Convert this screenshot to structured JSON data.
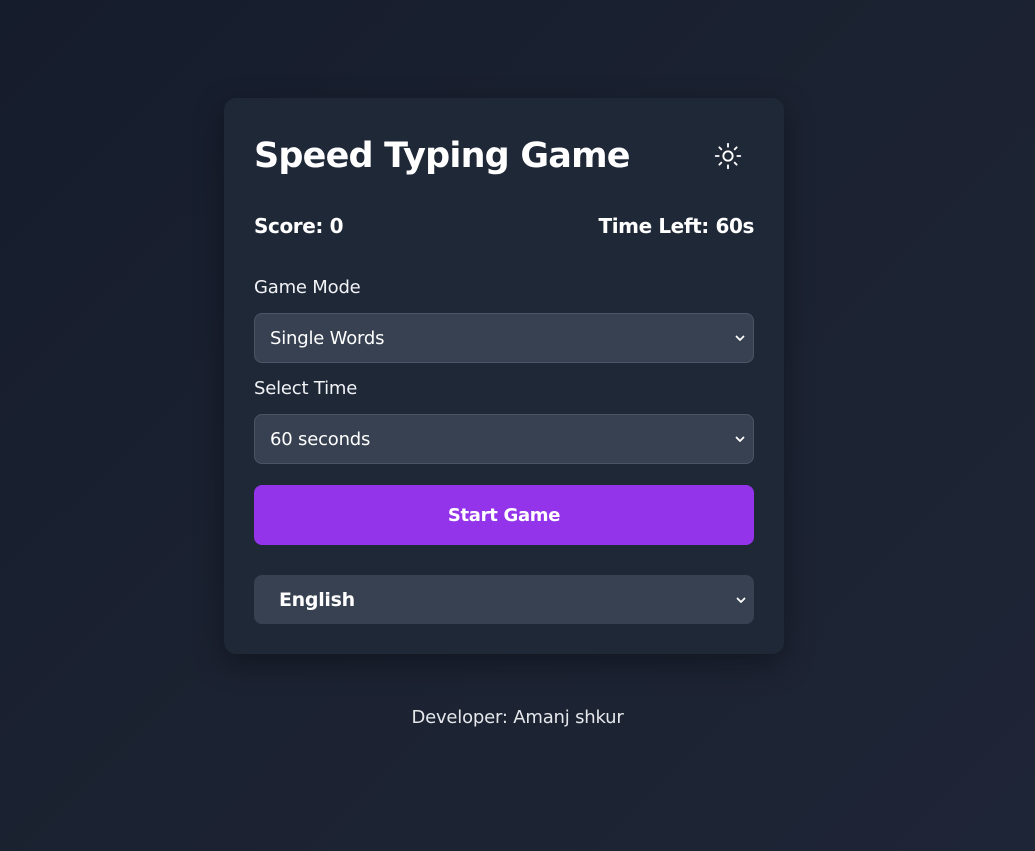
{
  "header": {
    "title": "Speed Typing Game",
    "theme_icon": "sun-icon"
  },
  "stats": {
    "score_label": "Score: 0",
    "time_left_label": "Time Left: 60s"
  },
  "game_mode": {
    "label": "Game Mode",
    "selected": "Single Words"
  },
  "time_select": {
    "label": "Select Time",
    "selected": "60 seconds"
  },
  "start_button": {
    "label": "Start Game"
  },
  "language_select": {
    "selected": "English"
  },
  "footer": {
    "text": "Developer: Amanj shkur"
  },
  "colors": {
    "background": "#1a2130",
    "card": "#1f2837",
    "select_bg": "#374151",
    "accent": "#9333ea",
    "text": "#ffffff"
  }
}
